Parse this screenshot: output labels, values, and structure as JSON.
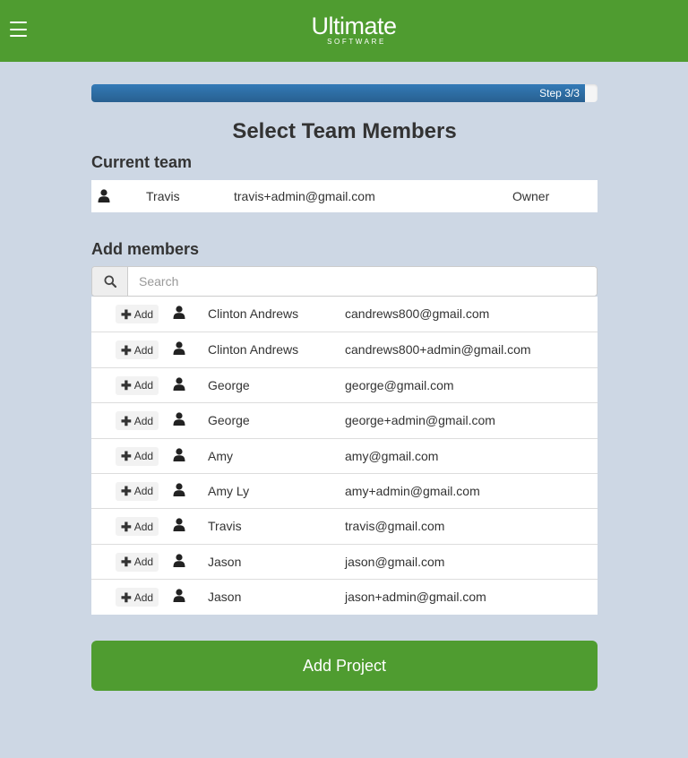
{
  "header": {
    "logo_main": "Ultimate",
    "logo_sub": "SOFTWARE",
    "menu_icon": "hamburger-menu-icon",
    "brand_color": "#4f9c30"
  },
  "progress": {
    "label": "Step 3/3",
    "fraction": 0.975
  },
  "page_title": "Select Team Members",
  "current_team": {
    "heading": "Current team",
    "members": [
      {
        "name": "Travis",
        "email": "travis+admin@gmail.com",
        "role": "Owner",
        "icon": "user-icon"
      }
    ]
  },
  "add_members": {
    "heading": "Add members",
    "search_placeholder": "Search",
    "search_icon": "search-icon",
    "add_label": "Add",
    "members": [
      {
        "name": "Clinton Andrews",
        "email": "candrews800@gmail.com"
      },
      {
        "name": "Clinton Andrews",
        "email": "candrews800+admin@gmail.com"
      },
      {
        "name": "George",
        "email": "george@gmail.com"
      },
      {
        "name": "George",
        "email": "george+admin@gmail.com"
      },
      {
        "name": "Amy",
        "email": "amy@gmail.com"
      },
      {
        "name": "Amy Ly",
        "email": "amy+admin@gmail.com"
      },
      {
        "name": "Travis",
        "email": "travis@gmail.com"
      },
      {
        "name": "Jason",
        "email": "jason@gmail.com"
      },
      {
        "name": "Jason",
        "email": "jason+admin@gmail.com"
      }
    ]
  },
  "submit_label": "Add Project"
}
